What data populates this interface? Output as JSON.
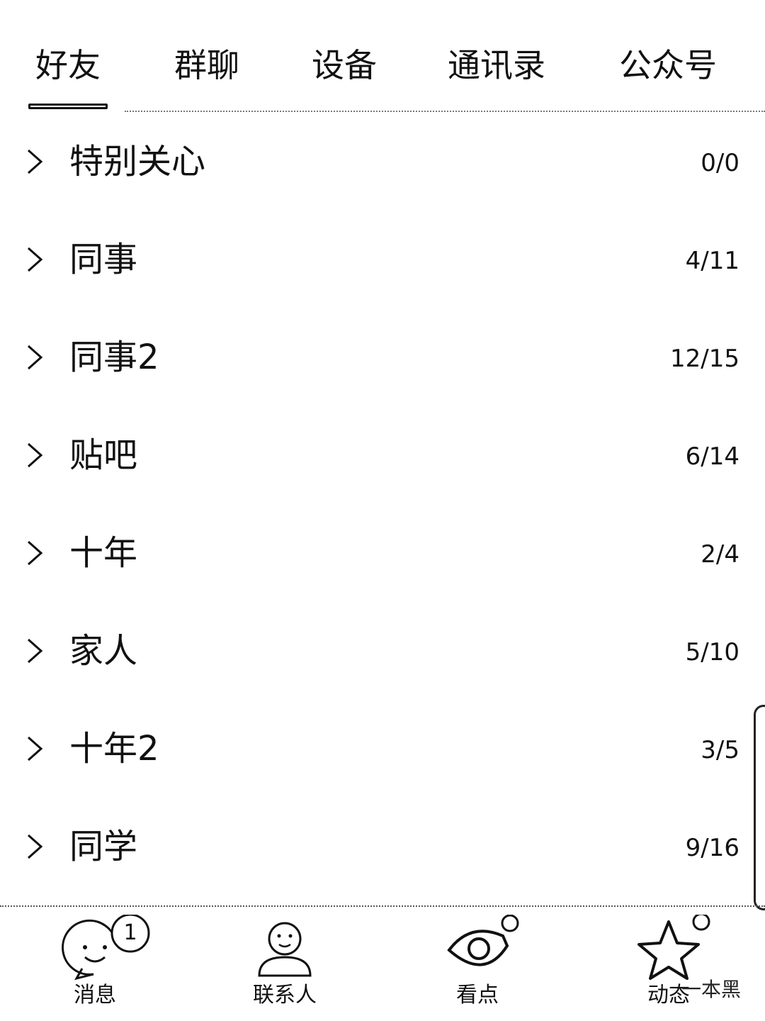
{
  "tabs": [
    {
      "label": "好友",
      "active": true
    },
    {
      "label": "群聊",
      "active": false
    },
    {
      "label": "设备",
      "active": false
    },
    {
      "label": "通讯录",
      "active": false
    },
    {
      "label": "公众号",
      "active": false
    }
  ],
  "groups": [
    {
      "name": "特别关心",
      "count": "0/0"
    },
    {
      "name": "同事",
      "count": "4/11"
    },
    {
      "name": "同事2",
      "count": "12/15"
    },
    {
      "name": "贴吧",
      "count": "6/14"
    },
    {
      "name": "十年",
      "count": "2/4"
    },
    {
      "name": "家人",
      "count": "5/10"
    },
    {
      "name": "十年2",
      "count": "3/5"
    },
    {
      "name": "同学",
      "count": "9/16"
    }
  ],
  "bottom_nav": [
    {
      "label": "消息",
      "icon": "chat-bubble-icon",
      "badge": "1"
    },
    {
      "label": "联系人",
      "icon": "contact-person-icon"
    },
    {
      "label": "看点",
      "icon": "eye-icon",
      "dot": true
    },
    {
      "label": "动态",
      "icon": "star-icon",
      "dot": true
    }
  ],
  "watermark": "一本黑"
}
